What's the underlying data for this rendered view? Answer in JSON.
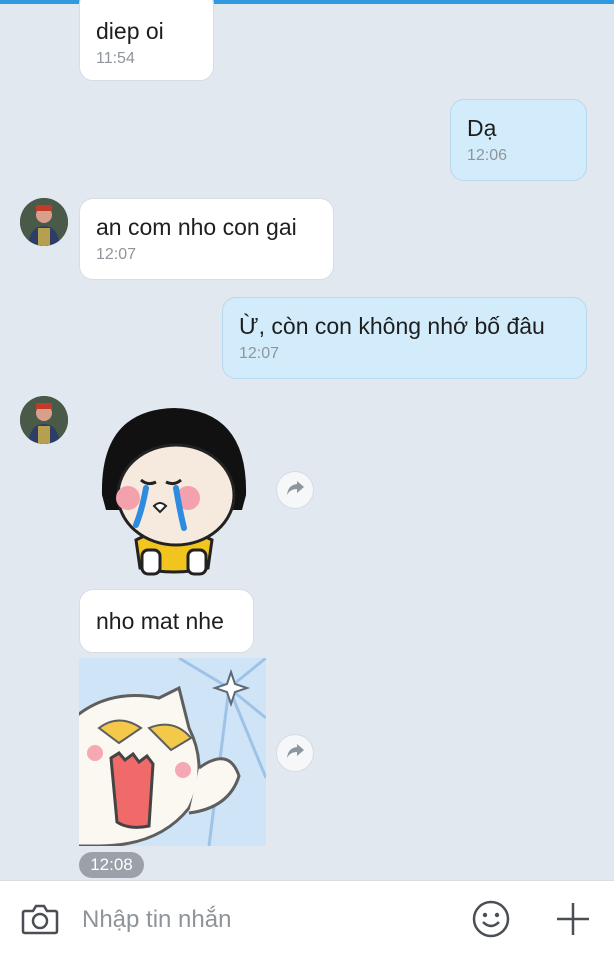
{
  "messages": [
    {
      "direction": "in",
      "text": "diep oi",
      "time": "11:54"
    },
    {
      "direction": "out",
      "text": "Dạ",
      "time": "12:06"
    },
    {
      "direction": "in",
      "text": "an com nho con gai",
      "time": "12:07"
    },
    {
      "direction": "out",
      "text": "Ừ, còn con không nhớ bố đâu",
      "time": "12:07"
    },
    {
      "direction": "in",
      "text": "nho mat nhe"
    }
  ],
  "sticker_time": "12:08",
  "composer": {
    "placeholder": "Nhập tin nhắn"
  },
  "icons": {
    "camera": "camera-icon",
    "emoji": "emoji-icon",
    "plus": "plus-icon",
    "forward": "forward-icon"
  },
  "colors": {
    "background": "#e2e8ef",
    "incoming_bubble": "#ffffff",
    "outgoing_bubble": "#d3ecfb",
    "accent": "#2f9ae0"
  }
}
